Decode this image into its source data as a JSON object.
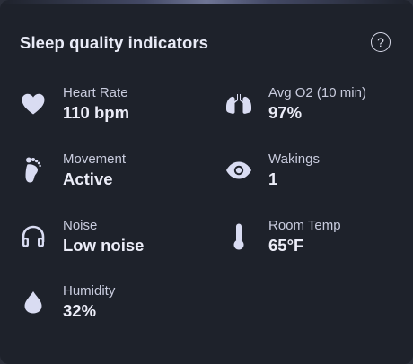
{
  "card": {
    "title": "Sleep quality indicators",
    "help_label": "?"
  },
  "colors": {
    "background": "#1e222b",
    "icon": "#d9dcf2",
    "text_primary": "#ecedf8",
    "text_secondary": "#c9ccde"
  },
  "indicators": [
    {
      "label": "Heart Rate",
      "value": "110 bpm",
      "icon": "heart-icon"
    },
    {
      "label": "Avg O2 (10 min)",
      "value": "97%",
      "icon": "lungs-icon"
    },
    {
      "label": "Movement",
      "value": "Active",
      "icon": "footprint-icon"
    },
    {
      "label": "Wakings",
      "value": "1",
      "icon": "eye-icon"
    },
    {
      "label": "Noise",
      "value": "Low noise",
      "icon": "headphones-icon"
    },
    {
      "label": "Room Temp",
      "value": "65°F",
      "icon": "thermometer-icon"
    },
    {
      "label": "Humidity",
      "value": "32%",
      "icon": "droplet-icon"
    }
  ]
}
